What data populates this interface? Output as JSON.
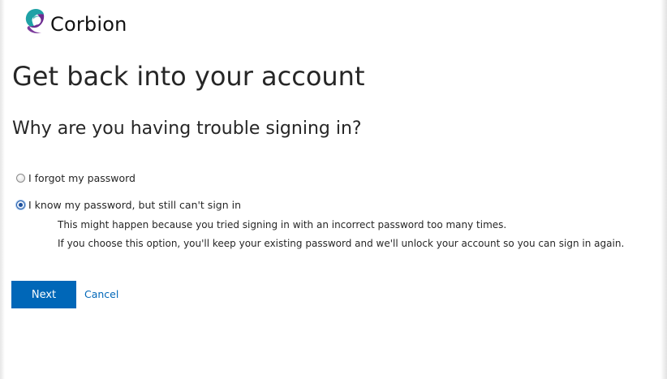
{
  "brand": {
    "name": "Corbion",
    "logo_icon": "corbion-logo-icon",
    "logo_colors": {
      "purple": "#6d2c91",
      "teal": "#1fa2a6"
    }
  },
  "page": {
    "title": "Get back into your account",
    "subtitle": "Why are you having trouble signing in?"
  },
  "options": [
    {
      "label": "I forgot my password",
      "selected": false
    },
    {
      "label": "I know my password, but still can't sign in",
      "selected": true,
      "description": [
        "This might happen because you tried signing in with an incorrect password too many times.",
        "If you choose this option, you'll keep your existing password and we'll unlock your account so you can sign in again."
      ]
    }
  ],
  "actions": {
    "next_label": "Next",
    "cancel_label": "Cancel",
    "accent_color": "#0067b8"
  }
}
